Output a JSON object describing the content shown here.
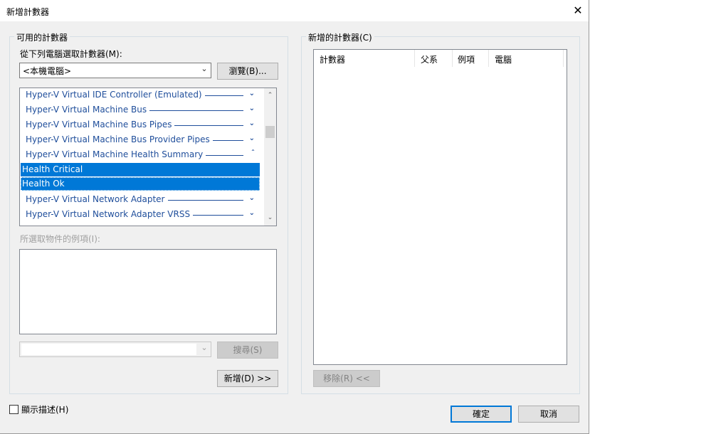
{
  "window": {
    "title": "新增計數器",
    "close_glyph": "✕"
  },
  "left_group": {
    "legend": "可用的計數器",
    "computer_label": "從下列電腦選取計數器(M):",
    "computer_value": "<本機電腦>",
    "browse_button": "瀏覽(B)...",
    "objects": [
      {
        "label": "Hyper-V Virtual IDE Controller (Emulated)",
        "expanded": false
      },
      {
        "label": "Hyper-V Virtual Machine Bus",
        "expanded": false
      },
      {
        "label": "Hyper-V Virtual Machine Bus Pipes",
        "expanded": false
      },
      {
        "label": "Hyper-V Virtual Machine Bus Provider Pipes",
        "expanded": false
      },
      {
        "label": "Hyper-V Virtual Machine Health Summary",
        "expanded": true
      }
    ],
    "counters": [
      "Health Critical",
      "Health Ok"
    ],
    "objects_after": [
      {
        "label": "Hyper-V Virtual Network Adapter",
        "expanded": false
      },
      {
        "label": "Hyper-V Virtual Network Adapter VRSS",
        "expanded": false
      }
    ],
    "instances_label": "所選取物件的例項(I):",
    "search_value": "",
    "search_button": "搜尋(S)",
    "add_button": "新增(D) >>"
  },
  "right_group": {
    "legend": "新增的計數器(C)",
    "columns": [
      "計數器",
      "父系",
      "例項",
      "電腦"
    ],
    "remove_button": "移除(R) <<"
  },
  "footer": {
    "show_description": "顯示描述(H)",
    "show_description_checked": false,
    "ok_button": "確定",
    "cancel_button": "取消"
  },
  "colors": {
    "selection": "#0078d7",
    "link_text": "#1f4e9b",
    "dialog_bg": "#f0f0f0"
  }
}
